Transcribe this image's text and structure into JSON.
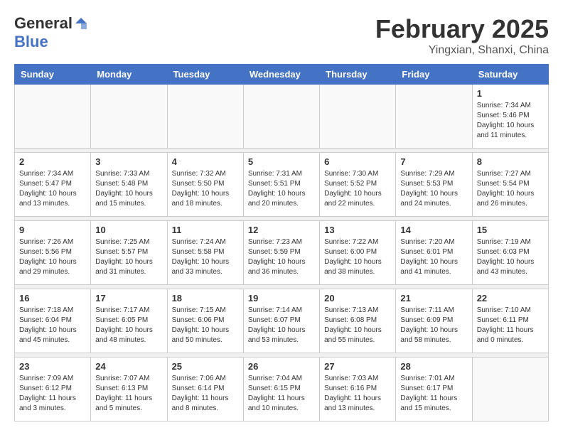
{
  "header": {
    "logo_general": "General",
    "logo_blue": "Blue",
    "month_title": "February 2025",
    "location": "Yingxian, Shanxi, China"
  },
  "weekdays": [
    "Sunday",
    "Monday",
    "Tuesday",
    "Wednesday",
    "Thursday",
    "Friday",
    "Saturday"
  ],
  "weeks": [
    [
      {
        "day": "",
        "info": ""
      },
      {
        "day": "",
        "info": ""
      },
      {
        "day": "",
        "info": ""
      },
      {
        "day": "",
        "info": ""
      },
      {
        "day": "",
        "info": ""
      },
      {
        "day": "",
        "info": ""
      },
      {
        "day": "1",
        "info": "Sunrise: 7:34 AM\nSunset: 5:46 PM\nDaylight: 10 hours and 11 minutes."
      }
    ],
    [
      {
        "day": "2",
        "info": "Sunrise: 7:34 AM\nSunset: 5:47 PM\nDaylight: 10 hours and 13 minutes."
      },
      {
        "day": "3",
        "info": "Sunrise: 7:33 AM\nSunset: 5:48 PM\nDaylight: 10 hours and 15 minutes."
      },
      {
        "day": "4",
        "info": "Sunrise: 7:32 AM\nSunset: 5:50 PM\nDaylight: 10 hours and 18 minutes."
      },
      {
        "day": "5",
        "info": "Sunrise: 7:31 AM\nSunset: 5:51 PM\nDaylight: 10 hours and 20 minutes."
      },
      {
        "day": "6",
        "info": "Sunrise: 7:30 AM\nSunset: 5:52 PM\nDaylight: 10 hours and 22 minutes."
      },
      {
        "day": "7",
        "info": "Sunrise: 7:29 AM\nSunset: 5:53 PM\nDaylight: 10 hours and 24 minutes."
      },
      {
        "day": "8",
        "info": "Sunrise: 7:27 AM\nSunset: 5:54 PM\nDaylight: 10 hours and 26 minutes."
      }
    ],
    [
      {
        "day": "9",
        "info": "Sunrise: 7:26 AM\nSunset: 5:56 PM\nDaylight: 10 hours and 29 minutes."
      },
      {
        "day": "10",
        "info": "Sunrise: 7:25 AM\nSunset: 5:57 PM\nDaylight: 10 hours and 31 minutes."
      },
      {
        "day": "11",
        "info": "Sunrise: 7:24 AM\nSunset: 5:58 PM\nDaylight: 10 hours and 33 minutes."
      },
      {
        "day": "12",
        "info": "Sunrise: 7:23 AM\nSunset: 5:59 PM\nDaylight: 10 hours and 36 minutes."
      },
      {
        "day": "13",
        "info": "Sunrise: 7:22 AM\nSunset: 6:00 PM\nDaylight: 10 hours and 38 minutes."
      },
      {
        "day": "14",
        "info": "Sunrise: 7:20 AM\nSunset: 6:01 PM\nDaylight: 10 hours and 41 minutes."
      },
      {
        "day": "15",
        "info": "Sunrise: 7:19 AM\nSunset: 6:03 PM\nDaylight: 10 hours and 43 minutes."
      }
    ],
    [
      {
        "day": "16",
        "info": "Sunrise: 7:18 AM\nSunset: 6:04 PM\nDaylight: 10 hours and 45 minutes."
      },
      {
        "day": "17",
        "info": "Sunrise: 7:17 AM\nSunset: 6:05 PM\nDaylight: 10 hours and 48 minutes."
      },
      {
        "day": "18",
        "info": "Sunrise: 7:15 AM\nSunset: 6:06 PM\nDaylight: 10 hours and 50 minutes."
      },
      {
        "day": "19",
        "info": "Sunrise: 7:14 AM\nSunset: 6:07 PM\nDaylight: 10 hours and 53 minutes."
      },
      {
        "day": "20",
        "info": "Sunrise: 7:13 AM\nSunset: 6:08 PM\nDaylight: 10 hours and 55 minutes."
      },
      {
        "day": "21",
        "info": "Sunrise: 7:11 AM\nSunset: 6:09 PM\nDaylight: 10 hours and 58 minutes."
      },
      {
        "day": "22",
        "info": "Sunrise: 7:10 AM\nSunset: 6:11 PM\nDaylight: 11 hours and 0 minutes."
      }
    ],
    [
      {
        "day": "23",
        "info": "Sunrise: 7:09 AM\nSunset: 6:12 PM\nDaylight: 11 hours and 3 minutes."
      },
      {
        "day": "24",
        "info": "Sunrise: 7:07 AM\nSunset: 6:13 PM\nDaylight: 11 hours and 5 minutes."
      },
      {
        "day": "25",
        "info": "Sunrise: 7:06 AM\nSunset: 6:14 PM\nDaylight: 11 hours and 8 minutes."
      },
      {
        "day": "26",
        "info": "Sunrise: 7:04 AM\nSunset: 6:15 PM\nDaylight: 11 hours and 10 minutes."
      },
      {
        "day": "27",
        "info": "Sunrise: 7:03 AM\nSunset: 6:16 PM\nDaylight: 11 hours and 13 minutes."
      },
      {
        "day": "28",
        "info": "Sunrise: 7:01 AM\nSunset: 6:17 PM\nDaylight: 11 hours and 15 minutes."
      },
      {
        "day": "",
        "info": ""
      }
    ]
  ]
}
